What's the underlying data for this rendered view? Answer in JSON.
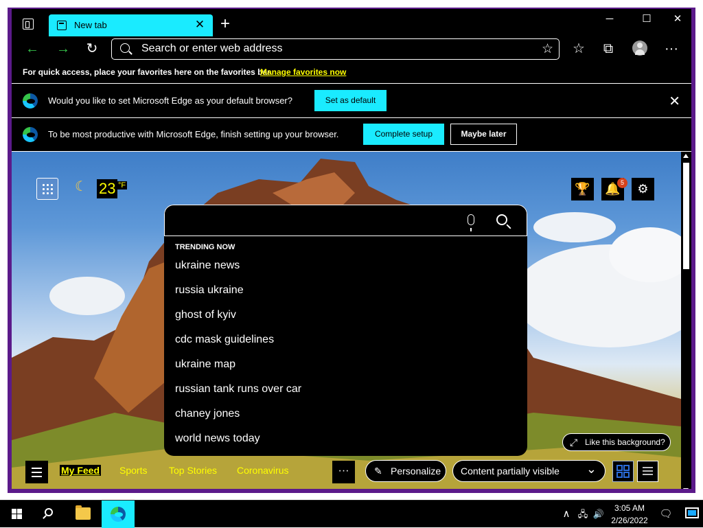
{
  "browser": {
    "tab": {
      "title": "New tab",
      "close_glyph": "✕"
    },
    "new_tab_glyph": "+",
    "window_controls": {
      "minimize": "─",
      "maximize": "☐",
      "close": "✕"
    },
    "toolbar": {
      "back_glyph": "←",
      "forward_glyph": "→",
      "refresh_glyph": "↻",
      "favorites_glyph": "☆",
      "collections_glyph": "⧉",
      "more_glyph": "···"
    },
    "address_bar": {
      "placeholder": "Search or enter web address",
      "add_favorite_glyph": "☆"
    },
    "favorites_bar": {
      "message": "For quick access, place your favorites here on the favorites bar.",
      "link": "Manage favorites now"
    },
    "default_prompt": {
      "message": "Would you like to set Microsoft Edge as your default browser?",
      "button": "Set as default",
      "close_glyph": "✕"
    },
    "setup_prompt": {
      "message": "To be most productive with Microsoft Edge, finish setting up your browser.",
      "primary_button": "Complete setup",
      "secondary_button": "Maybe later"
    }
  },
  "new_tab_page": {
    "weather": {
      "temperature": "23",
      "unit": "°F",
      "icon": "moon-icon"
    },
    "rewards_glyph": "🏆",
    "notifications": {
      "count": "5",
      "glyph": "🔔"
    },
    "settings_glyph": "⚙",
    "search": {
      "trending_heading": "TRENDING NOW",
      "trending": [
        "ukraine news",
        "russia ukraine",
        "ghost of kyiv",
        "cdc mask guidelines",
        "ukraine map",
        "russian tank runs over car",
        "chaney jones",
        "world news today"
      ]
    },
    "like_background": {
      "label": "Like this background?",
      "glyph": "⤢"
    },
    "feed": {
      "tabs": [
        "My Feed",
        "Sports",
        "Top Stories",
        "Coronavirus"
      ],
      "more_glyph": "···",
      "personalize": {
        "label": "Personalize",
        "glyph": "✎"
      },
      "content_visibility": {
        "label": "Content partially visible",
        "glyph": "⌄"
      }
    }
  },
  "taskbar": {
    "tray_chevron": "∧",
    "network_glyph": "🖧",
    "volume_glyph": "🔊",
    "clock": {
      "time": "3:05 AM",
      "date": "2/26/2022"
    },
    "notification_glyph": "🗨"
  },
  "colors": {
    "accent_cyan": "#1aebff",
    "highlight_yellow": "#ffff00",
    "window_frame": "#5b1a8a",
    "badge": "#d4421c"
  }
}
